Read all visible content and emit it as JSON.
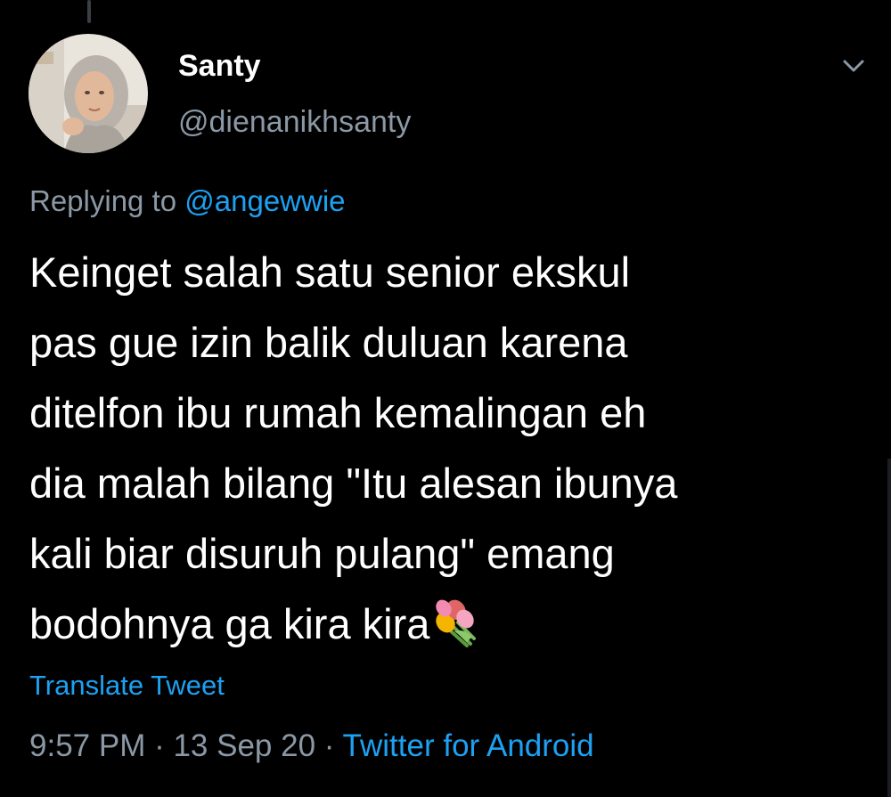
{
  "tweet": {
    "author": {
      "display_name": "Santy",
      "handle": "@dienanikhsanty"
    },
    "reply": {
      "prefix": "Replying to ",
      "mention": "@angewwie"
    },
    "text_lines": [
      "Keinget salah satu senior ekskul",
      "pas gue izin balik duluan karena",
      "ditelfon ibu rumah kemalingan eh",
      "dia malah bilang \"Itu alesan ibunya",
      "kali biar disuruh pulang\" emang",
      "bodohnya ga kira kira"
    ],
    "emoji": "tulip-bouquet-emoji",
    "translate_label": "Translate Tweet",
    "meta": {
      "time": "9:57 PM",
      "separator1": " · ",
      "date": "13 Sep 20",
      "separator2": " · ",
      "source": "Twitter for Android"
    }
  },
  "icons": {
    "menu": "chevron-down-icon",
    "avatar": "profile-avatar"
  },
  "colors": {
    "background": "#000000",
    "primary_text": "#ffffff",
    "secondary_text": "#8b98a5",
    "accent": "#1da1f2"
  }
}
